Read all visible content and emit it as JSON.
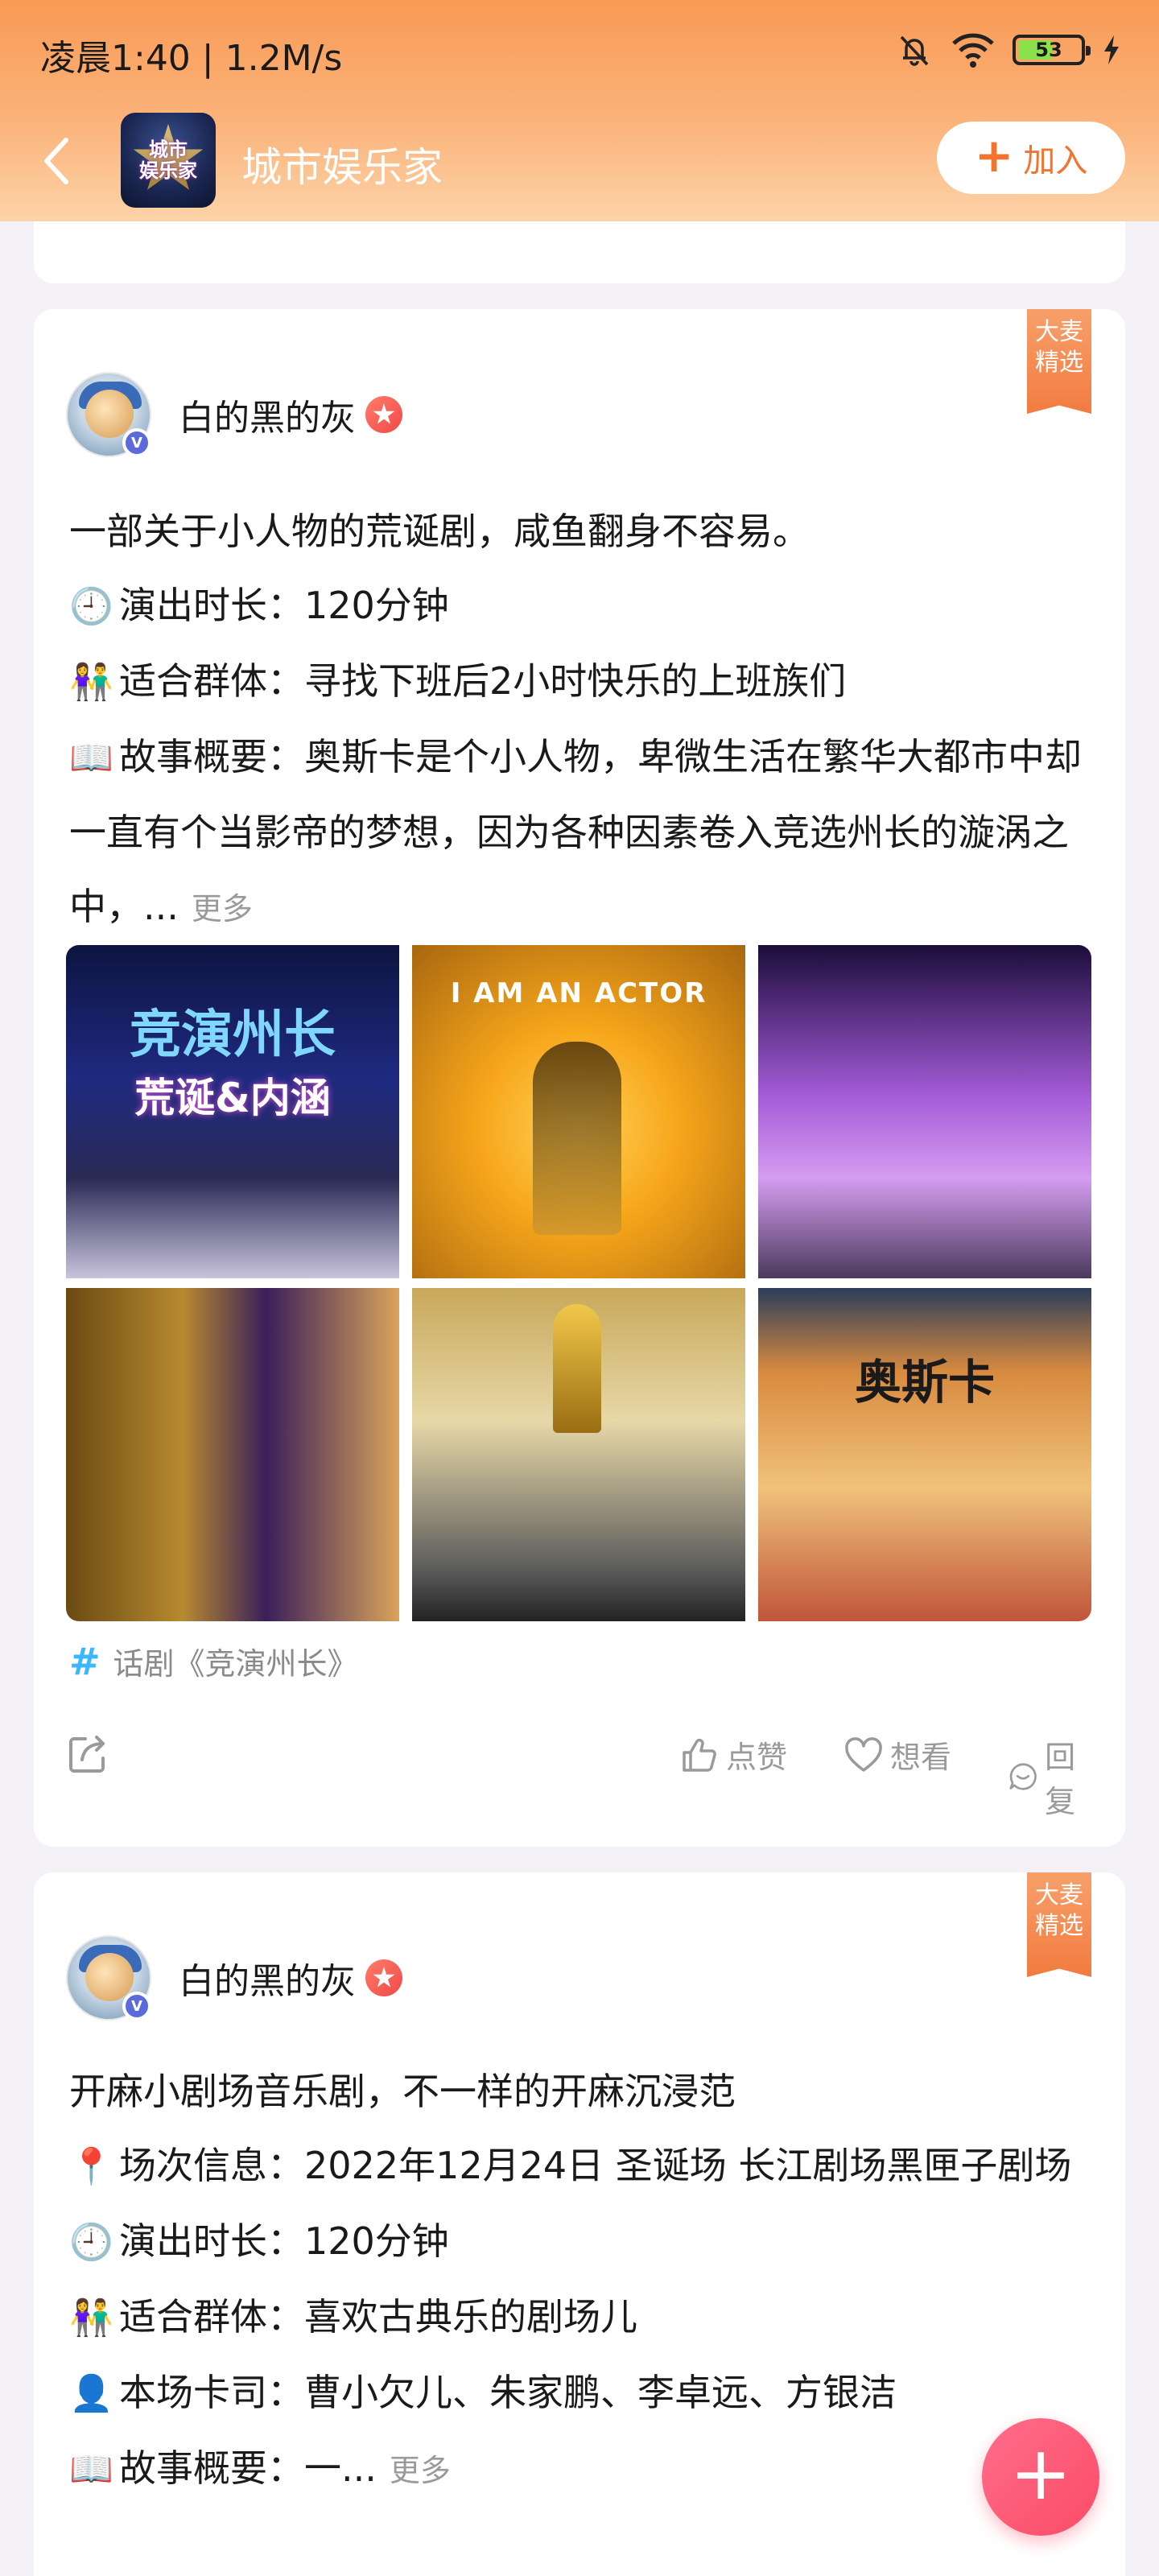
{
  "status_bar": {
    "time": "凌晨1:40 | 1.2M/s",
    "battery": "53"
  },
  "header": {
    "title": "城市娱乐家",
    "join_label": "加入",
    "logo_text": "城市\n娱乐家"
  },
  "colors": {
    "accent": "#f2742f",
    "topic": "#3cb7ff",
    "fab": "#fb4b66"
  },
  "posts": [
    {
      "badge": "大麦\n精选",
      "author": "白的黑的灰",
      "lines": [
        {
          "icon": "",
          "text": "一部关于小人物的荒诞剧，咸鱼翻身不容易。"
        },
        {
          "icon": "🕘",
          "text": "演出时长：120分钟"
        },
        {
          "icon": "👫",
          "text": "适合群体：寻找下班后2小时快乐的上班族们"
        },
        {
          "icon": "📖",
          "text": "故事概要：奥斯卡是个小人物，卑微生活在繁华大都市中却一直有个当影帝的梦想，因为各种因素卷入竞选州长的漩涡之中，..."
        }
      ],
      "more": "更多",
      "images": [
        {
          "name": "poster-1",
          "caption": "竞演州长",
          "caption2": "荒诞&内涵"
        },
        {
          "name": "poster-2",
          "caption": "I AM AN ACTOR",
          "caption2": ""
        },
        {
          "name": "stage-photo-3",
          "caption": "",
          "caption2": ""
        },
        {
          "name": "stage-photo-4",
          "caption": "",
          "caption2": ""
        },
        {
          "name": "stage-photo-5",
          "caption": "",
          "caption2": ""
        },
        {
          "name": "stage-photo-6",
          "caption": "奥斯卡",
          "caption2": ""
        }
      ],
      "topic": "话剧《竞演州长》",
      "actions": {
        "like": "点赞",
        "want": "想看",
        "reply": "回复"
      }
    },
    {
      "badge": "大麦\n精选",
      "author": "白的黑的灰",
      "lines": [
        {
          "icon": "",
          "text": "开麻小剧场音乐剧，不一样的开麻沉浸范"
        },
        {
          "icon": "📍",
          "text": "场次信息：2022年12月24日 圣诞场 长江剧场黑匣子剧场"
        },
        {
          "icon": "🕘",
          "text": "演出时长：120分钟"
        },
        {
          "icon": "👫",
          "text": "适合群体：喜欢古典乐的剧场儿"
        },
        {
          "icon": "👤",
          "text": "本场卡司：曹小欠儿、朱家鹏、李卓远、方银洁"
        },
        {
          "icon": "📖",
          "text": "故事概要：一..."
        }
      ],
      "more": "更多"
    }
  ],
  "fab_label": "+"
}
